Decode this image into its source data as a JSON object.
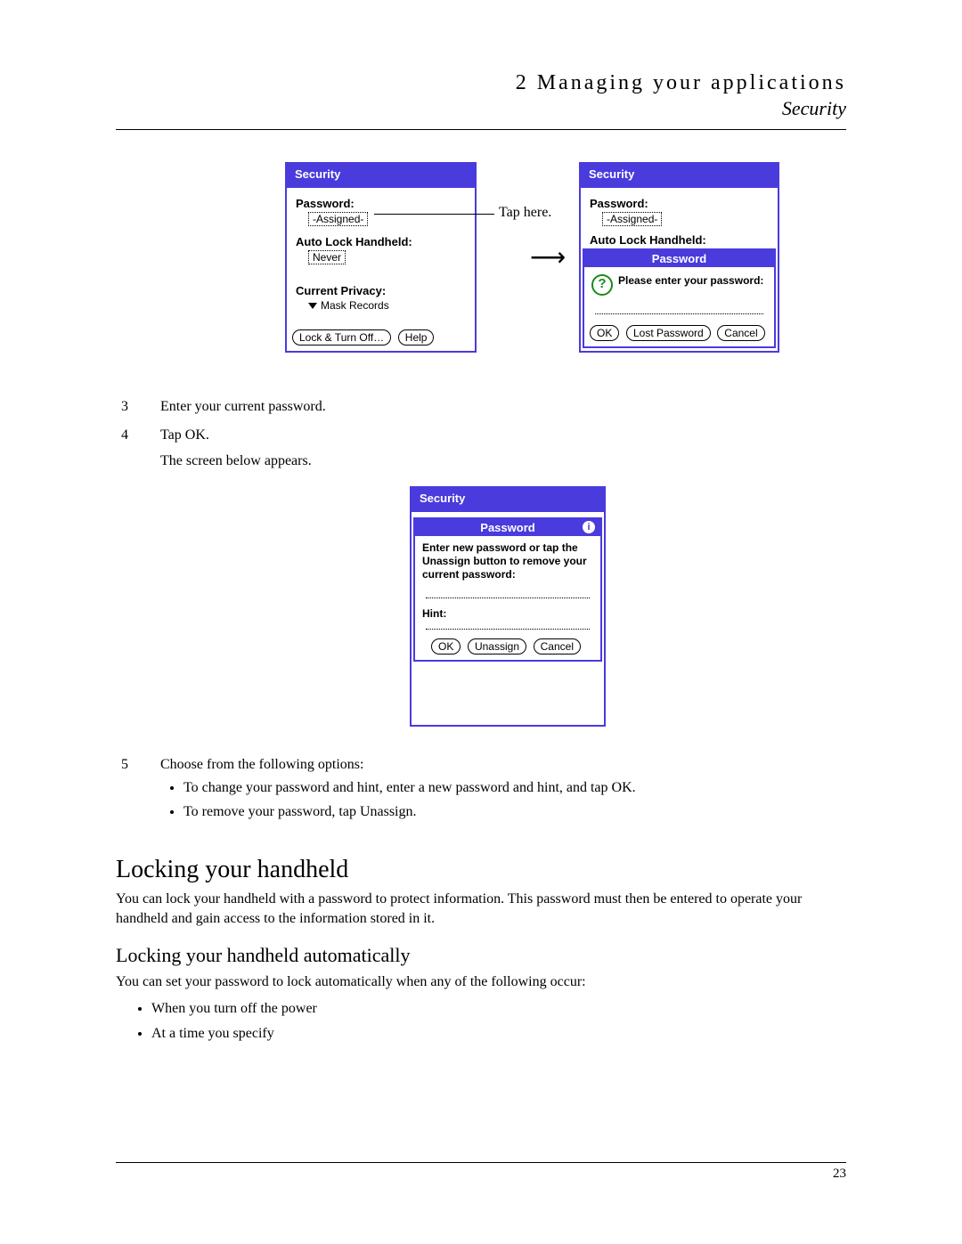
{
  "header": {
    "chapter_num": "2",
    "chapter_title": "Managing your applications",
    "section": "Security"
  },
  "fig1": {
    "title": "Security",
    "password_label": "Password:",
    "password_value": "-Assigned-",
    "autolock_label": "Auto Lock Handheld:",
    "autolock_value": "Never",
    "privacy_label": "Current Privacy:",
    "privacy_value": "Mask Records",
    "btn_lock": "Lock & Turn Off…",
    "btn_help": "Help",
    "callout": "Tap here."
  },
  "fig2": {
    "title": "Security",
    "password_label": "Password:",
    "password_value": "-Assigned-",
    "autolock_label": "Auto Lock Handheld:",
    "dialog_title": "Password",
    "prompt": "Please enter your password:",
    "btn_ok": "OK",
    "btn_lost": "Lost Password",
    "btn_cancel": "Cancel"
  },
  "steps_a": [
    {
      "n": "3",
      "t": "Enter your current password."
    },
    {
      "n": "4",
      "t": "Tap OK."
    }
  ],
  "step4_sub": "The screen below appears.",
  "fig3": {
    "title": "Security",
    "dialog_title": "Password",
    "prompt": "Enter new password or tap the Unassign button to remove your current password:",
    "hint_label": "Hint:",
    "btn_ok": "OK",
    "btn_unassign": "Unassign",
    "btn_cancel": "Cancel"
  },
  "step5": {
    "n": "5",
    "t": "Choose from the following options:"
  },
  "step5_opts": [
    "To change your password and hint, enter a new password and hint, and tap OK.",
    "To remove your password, tap Unassign."
  ],
  "h2": "Locking your handheld",
  "h2_body": "You can lock your handheld with a password to protect information. This password must then be entered to operate your handheld and gain access to the information stored in it.",
  "h3": "Locking your handheld automatically",
  "h3_body": "You can set your password to lock automatically when any of the following occur:",
  "h3_opts": [
    "When you turn off the power",
    "At a time you specify"
  ],
  "page_number": "23"
}
